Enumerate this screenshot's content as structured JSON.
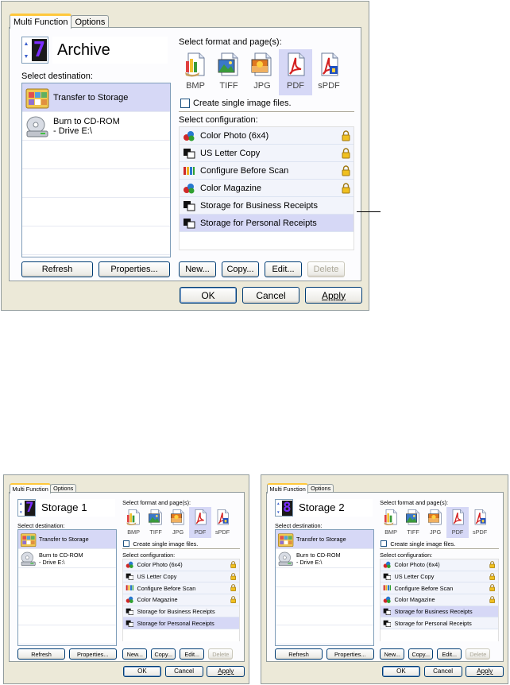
{
  "tabs": {
    "multi_function": "Multi Function",
    "options": "Options"
  },
  "labels": {
    "select_destination": "Select destination:",
    "select_format": "Select format and page(s):",
    "create_single": "Create single image files.",
    "select_configuration": "Select configuration:"
  },
  "destinations": [
    {
      "label": "Transfer to Storage",
      "sub": ""
    },
    {
      "label": "Burn to CD-ROM",
      "sub": "- Drive E:\\"
    }
  ],
  "formats": [
    "BMP",
    "TIFF",
    "JPG",
    "PDF",
    "sPDF"
  ],
  "configurations": [
    {
      "label": "Color Photo (6x4)",
      "locked": true
    },
    {
      "label": "US Letter Copy",
      "locked": true
    },
    {
      "label": "Configure Before Scan",
      "locked": true
    },
    {
      "label": "Color Magazine",
      "locked": true
    },
    {
      "label": "Storage for Business Receipts",
      "locked": false
    },
    {
      "label": "Storage for Personal Receipts",
      "locked": false
    }
  ],
  "buttons": {
    "refresh": "Refresh",
    "properties": "Properties...",
    "new": "New...",
    "copy": "Copy...",
    "edit": "Edit...",
    "delete": "Delete",
    "ok": "OK",
    "cancel": "Cancel",
    "apply": "Apply"
  },
  "dialogs": [
    {
      "id": "main",
      "digit": "7",
      "name": "Archive",
      "selected_dest": 0,
      "selected_format": 3,
      "selected_config": 5
    },
    {
      "id": "small-left",
      "digit": "7",
      "name": "Storage 1",
      "selected_dest": 0,
      "selected_format": 3,
      "selected_config": 5
    },
    {
      "id": "small-right",
      "digit": "8",
      "name": "Storage 2",
      "selected_dest": 0,
      "selected_format": 3,
      "selected_config": 4
    }
  ],
  "colors": {
    "selection": "#d6d8f6",
    "dialog_bg": "#ece9d8",
    "tab_accent": "#ffc83c"
  }
}
